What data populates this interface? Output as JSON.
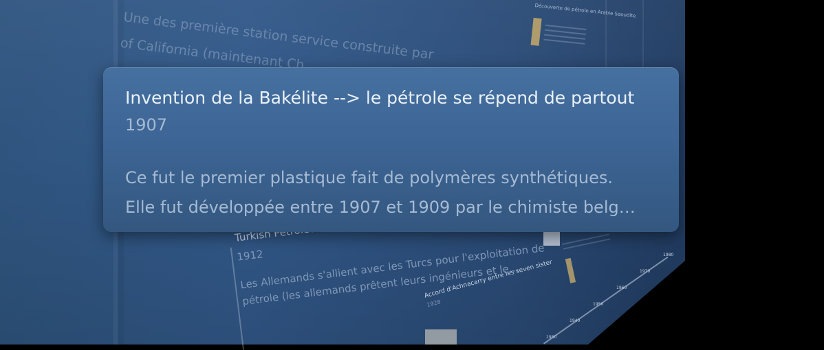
{
  "background": {
    "top_event_text": [
      "Une des première station service construite par",
      "of California (maintenant Ch"
    ],
    "event_turkish": {
      "title": "Turkish Petroleum Company",
      "date": "1912",
      "description": [
        "Les Allemands s'allient avec les Turcs pour l'exploitation de",
        "pétrole (les allemands prêtent leurs ingénieurs et le..."
      ]
    },
    "event_achnacarry": {
      "title": "Accord d'Achnacarry entre les seven sister",
      "date": "1928"
    },
    "right_column_title": "Découverte de pétrole en Arabie Saoudite",
    "timeline_ticks": [
      "1930",
      "1940",
      "1950",
      "1960",
      "1970",
      "1980"
    ]
  },
  "tooltip": {
    "title": "Invention de la Bakélite --> le pétrole se répend de partout",
    "date": "1907",
    "description_lines": [
      "Ce fut le premier plastique fait de polymères synthétiques.",
      "Elle fut développée entre 1907 et 1909 par le chimiste belg…"
    ]
  },
  "colors": {
    "wall": "#2f557f",
    "tooltip": "#3d6595",
    "title_text": "#eaf1f9",
    "secondary_text": "#a6bad3"
  }
}
